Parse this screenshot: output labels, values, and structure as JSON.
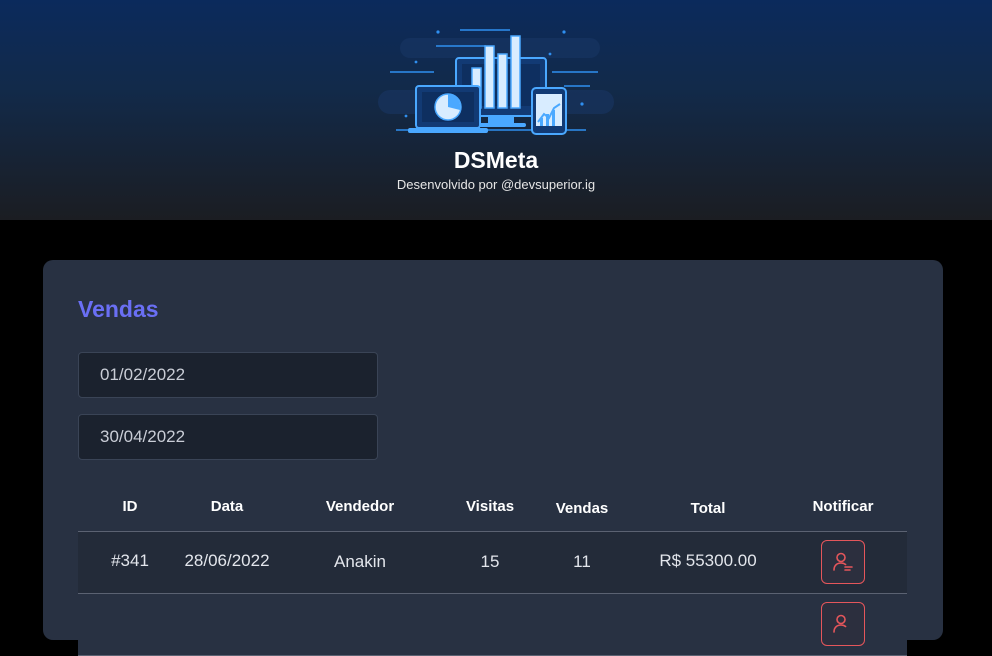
{
  "header": {
    "title": "DSMeta",
    "subtitle": "Desenvolvido por @devsuperior.ig"
  },
  "sales": {
    "title": "Vendas",
    "min_date": "01/02/2022",
    "max_date": "30/04/2022",
    "columns": [
      "ID",
      "Data",
      "Vendedor",
      "Visitas",
      "Vendas",
      "Total",
      "Notificar"
    ],
    "rows": [
      {
        "id": "#341",
        "date": "28/06/2022",
        "seller": "Anakin",
        "visits": "15",
        "deals": "11",
        "total": "R$ 55300.00"
      }
    ]
  },
  "colors": {
    "accent": "#6a6ff4",
    "notify": "#e5565b",
    "card": "#283142"
  },
  "icons": {
    "logo": "dashboard-devices-illustration",
    "notify": "user-notify-icon"
  }
}
